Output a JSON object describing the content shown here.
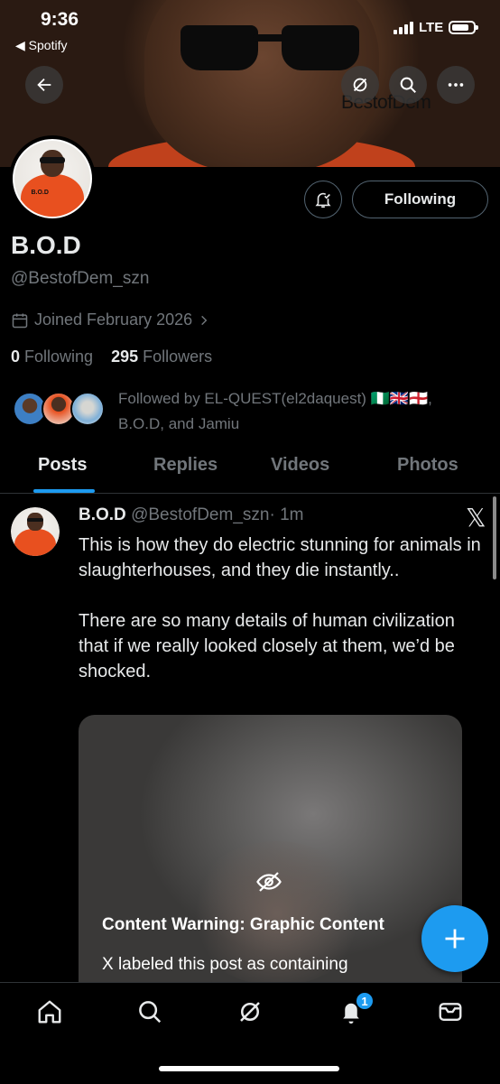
{
  "status_bar": {
    "time": "9:36",
    "back_app": "◀ Spotify",
    "network": "LTE"
  },
  "banner": {
    "brand_text": "BestofDem"
  },
  "profile": {
    "name": "B.O.D",
    "handle": "@BestofDem_szn",
    "joined": "Joined February 2026",
    "following_count": "0",
    "following_label": "Following",
    "followers_count": "295",
    "followers_label": "Followers",
    "followed_by": "Followed by EL-QUEST(el2daquest) 🇳🇬🇬🇧🏴󠁧󠁢󠁥󠁮󠁧󠁿, B.O.D, and Jamiu",
    "follow_button": "Following",
    "avatar_text": "B.O.D"
  },
  "tabs": [
    {
      "label": "Posts",
      "active": true
    },
    {
      "label": "Replies",
      "active": false
    },
    {
      "label": "Videos",
      "active": false
    },
    {
      "label": "Photos",
      "active": false
    }
  ],
  "post": {
    "author": "B.O.D",
    "handle": "@BestofDem_szn",
    "time": "· 1m",
    "text": "This is how they do electric stunning for animals in slaughterhouses, and they die instantly..\n\nThere are so many details of human civilization that if we really looked closely at them, we’d be shocked.",
    "content_warning_title": "Content Warning: Graphic Content",
    "content_warning_text": "X labeled this post as containing"
  },
  "nav": {
    "notification_badge": "1",
    "icons": [
      "home-icon",
      "search-icon",
      "grok-icon",
      "bell-icon",
      "mail-icon"
    ]
  },
  "colors": {
    "accent": "#1d9bf0",
    "background": "#000000",
    "secondary_text": "#71767b"
  }
}
